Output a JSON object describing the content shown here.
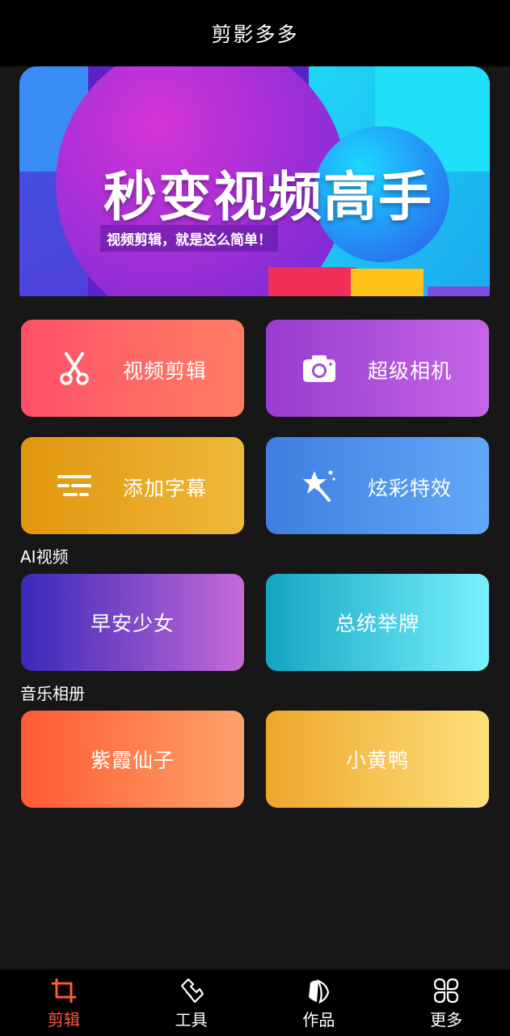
{
  "app": {
    "title": "剪影多多"
  },
  "banner": {
    "headline": "秒变视频高手",
    "subline": "视频剪辑，就是这么简单！"
  },
  "features": [
    {
      "label": "视频剪辑",
      "icon": "scissors-icon"
    },
    {
      "label": "超级相机",
      "icon": "camera-icon"
    },
    {
      "label": "添加字幕",
      "icon": "subtitle-icon"
    },
    {
      "label": "炫彩特效",
      "icon": "magic-star-icon"
    }
  ],
  "sections": {
    "ai_video": {
      "title": "AI视频",
      "items": [
        "早安少女",
        "总统举牌"
      ]
    },
    "music_album": {
      "title": "音乐相册",
      "items": [
        "紫霞仙子",
        "小黄鸭"
      ]
    }
  },
  "tabs": [
    {
      "label": "剪辑",
      "icon": "crop-icon",
      "active": true
    },
    {
      "label": "工具",
      "icon": "tool-icon",
      "active": false
    },
    {
      "label": "作品",
      "icon": "works-icon",
      "active": false
    },
    {
      "label": "更多",
      "icon": "more-grid-icon",
      "active": false
    }
  ],
  "colors": {
    "active_tab": "#ff5a3c",
    "background": "#171717",
    "bar": "#000000"
  }
}
